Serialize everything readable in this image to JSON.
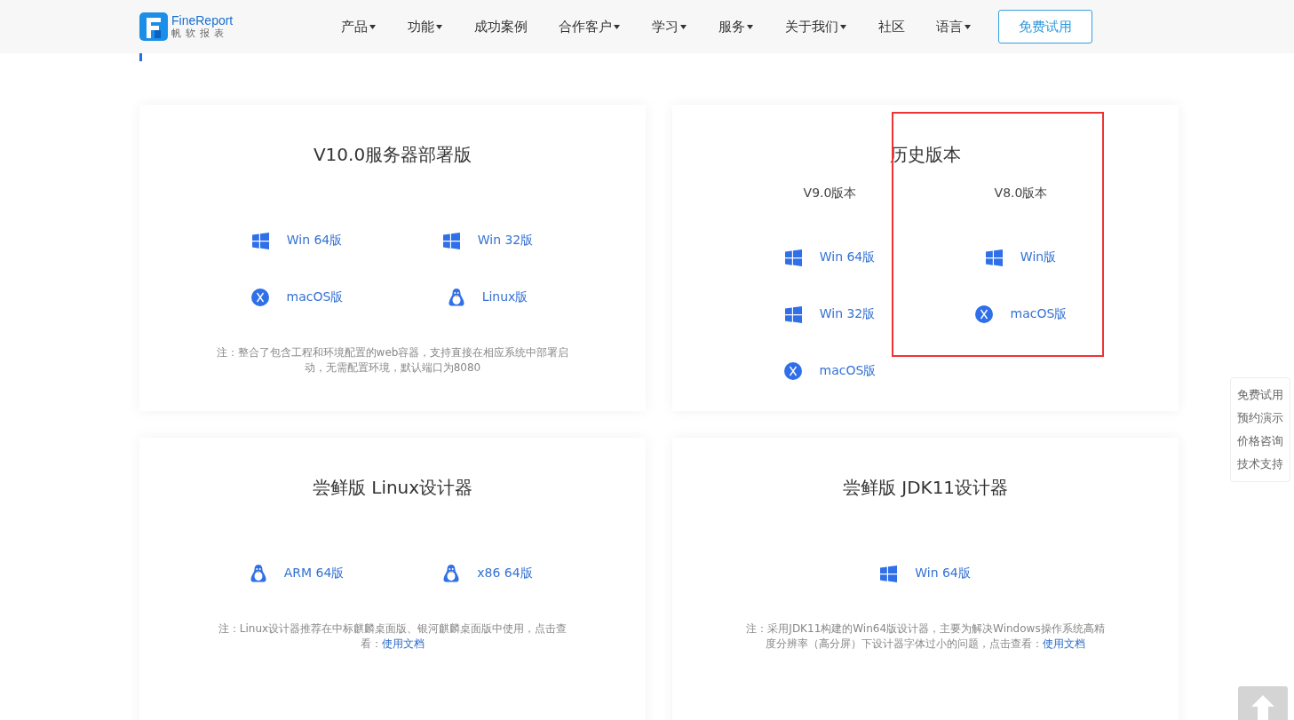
{
  "header": {
    "logo": {
      "name": "FineReport",
      "subtitle": "帆软报表"
    },
    "nav": [
      {
        "label": "产品",
        "dropdown": true
      },
      {
        "label": "功能",
        "dropdown": true
      },
      {
        "label": "成功案例",
        "dropdown": false
      },
      {
        "label": "合作客户",
        "dropdown": true
      },
      {
        "label": "学习",
        "dropdown": true
      },
      {
        "label": "服务",
        "dropdown": true
      },
      {
        "label": "关于我们",
        "dropdown": true
      },
      {
        "label": "社区",
        "dropdown": false
      },
      {
        "label": "语言",
        "dropdown": true
      }
    ],
    "cta": "免费试用"
  },
  "cards": [
    {
      "kind": "grid",
      "title": "V10.0服务器部署版",
      "items": [
        {
          "kind": "windows",
          "label": "Win 64版"
        },
        {
          "kind": "windows",
          "label": "Win 32版"
        },
        {
          "kind": "mac",
          "label": "macOS版"
        },
        {
          "kind": "linux",
          "label": "Linux版"
        }
      ],
      "note": {
        "text": "注：整合了包含工程和环境配置的web容器，支持直接在相应系统中部署启动，无需配置环境，默认端口为8080"
      }
    },
    {
      "kind": "versions",
      "title": "历史版本",
      "groups": [
        {
          "heading": "V9.0版本",
          "items": [
            {
              "kind": "windows",
              "label": "Win 64版"
            },
            {
              "kind": "windows",
              "label": "Win 32版"
            },
            {
              "kind": "mac",
              "label": "macOS版"
            }
          ]
        },
        {
          "heading": "V8.0版本",
          "items": [
            {
              "kind": "windows",
              "label": "Win版"
            },
            {
              "kind": "mac",
              "label": "macOS版"
            }
          ]
        }
      ]
    },
    {
      "kind": "grid",
      "title": "尝鲜版 Linux设计器",
      "items": [
        {
          "kind": "linux",
          "label": "ARM 64版"
        },
        {
          "kind": "linux",
          "label": "x86 64版"
        }
      ],
      "note": {
        "text": "注：Linux设计器推荐在中标麒麟桌面版、银河麒麟桌面版中使用，点击查看：",
        "link": "使用文档"
      }
    },
    {
      "kind": "grid",
      "title": "尝鲜版 JDK11设计器",
      "items": [
        {
          "kind": "windows",
          "label": "Win 64版"
        }
      ],
      "note": {
        "text": "注：采用JDK11构建的Win64版设计器，主要为解决Windows操作系统高精度分辨率（高分屏）下设计器字体过小的问题，点击查看：",
        "link": "使用文档"
      }
    }
  ],
  "side_menu": [
    "免费试用",
    "预约演示",
    "价格咨询",
    "技术支持"
  ]
}
